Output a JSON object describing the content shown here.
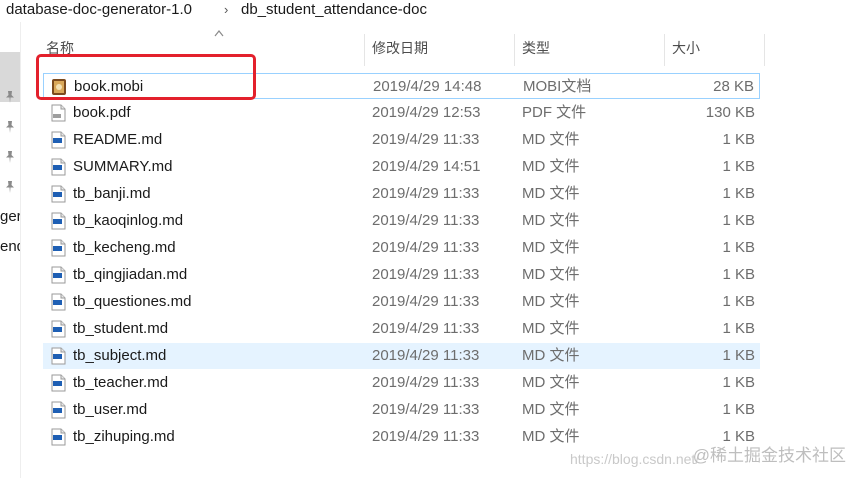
{
  "breadcrumb": {
    "segments": [
      "database-doc-generator-1.0",
      "db_student_attendance-doc"
    ],
    "separator": "›"
  },
  "left_pane": {
    "cut_labels": [
      "ger",
      "end"
    ]
  },
  "columns": {
    "name": "名称",
    "date": "修改日期",
    "type": "类型",
    "size": "大小"
  },
  "files": [
    {
      "name": "book.mobi",
      "date": "2019/4/29 14:48",
      "type": "MOBI文档",
      "size": "28 KB",
      "icon": "mobi-book-icon"
    },
    {
      "name": "book.pdf",
      "date": "2019/4/29 12:53",
      "type": "PDF 文件",
      "size": "130 KB",
      "icon": "pdf-file-icon"
    },
    {
      "name": "README.md",
      "date": "2019/4/29 11:33",
      "type": "MD 文件",
      "size": "1 KB",
      "icon": "md-file-icon"
    },
    {
      "name": "SUMMARY.md",
      "date": "2019/4/29 14:51",
      "type": "MD 文件",
      "size": "1 KB",
      "icon": "md-file-icon"
    },
    {
      "name": "tb_banji.md",
      "date": "2019/4/29 11:33",
      "type": "MD 文件",
      "size": "1 KB",
      "icon": "md-file-icon"
    },
    {
      "name": "tb_kaoqinlog.md",
      "date": "2019/4/29 11:33",
      "type": "MD 文件",
      "size": "1 KB",
      "icon": "md-file-icon"
    },
    {
      "name": "tb_kecheng.md",
      "date": "2019/4/29 11:33",
      "type": "MD 文件",
      "size": "1 KB",
      "icon": "md-file-icon"
    },
    {
      "name": "tb_qingjiadan.md",
      "date": "2019/4/29 11:33",
      "type": "MD 文件",
      "size": "1 KB",
      "icon": "md-file-icon"
    },
    {
      "name": "tb_questiones.md",
      "date": "2019/4/29 11:33",
      "type": "MD 文件",
      "size": "1 KB",
      "icon": "md-file-icon"
    },
    {
      "name": "tb_student.md",
      "date": "2019/4/29 11:33",
      "type": "MD 文件",
      "size": "1 KB",
      "icon": "md-file-icon"
    },
    {
      "name": "tb_subject.md",
      "date": "2019/4/29 11:33",
      "type": "MD 文件",
      "size": "1 KB",
      "icon": "md-file-icon"
    },
    {
      "name": "tb_teacher.md",
      "date": "2019/4/29 11:33",
      "type": "MD 文件",
      "size": "1 KB",
      "icon": "md-file-icon"
    },
    {
      "name": "tb_user.md",
      "date": "2019/4/29 11:33",
      "type": "MD 文件",
      "size": "1 KB",
      "icon": "md-file-icon"
    },
    {
      "name": "tb_zihuping.md",
      "date": "2019/4/29 11:33",
      "type": "MD 文件",
      "size": "1 KB",
      "icon": "md-file-icon"
    }
  ],
  "watermark": {
    "brand": "@稀土掘金技术社区",
    "url": "https://blog.csdn.net/"
  },
  "colors": {
    "annotation_red": "#e3202c",
    "focus_border": "#99d1ff",
    "hover_bg": "#e5f3ff"
  }
}
